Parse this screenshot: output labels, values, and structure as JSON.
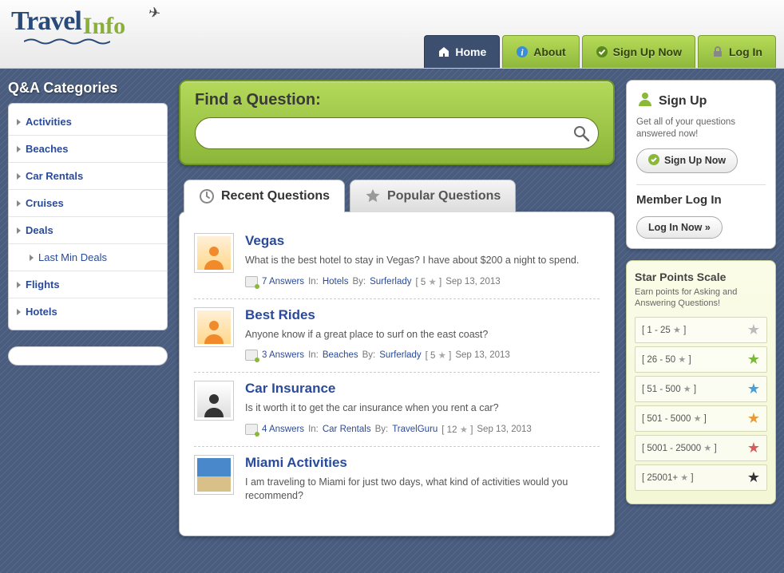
{
  "logo": {
    "word1": "Travel",
    "word2": "Info"
  },
  "nav": [
    {
      "label": "Home",
      "icon": "home",
      "active": true
    },
    {
      "label": "About",
      "icon": "info",
      "active": false
    },
    {
      "label": "Sign Up Now",
      "icon": "check",
      "active": false
    },
    {
      "label": "Log In",
      "icon": "lock",
      "active": false
    }
  ],
  "sidebar": {
    "title": "Q&A Categories",
    "items": [
      {
        "label": "Activities"
      },
      {
        "label": "Beaches"
      },
      {
        "label": "Car Rentals"
      },
      {
        "label": "Cruises"
      },
      {
        "label": "Deals"
      },
      {
        "label": "Last Min Deals",
        "sub": true
      },
      {
        "label": "Flights"
      },
      {
        "label": "Hotels"
      }
    ]
  },
  "search": {
    "title": "Find a Question:",
    "value": "",
    "placeholder": ""
  },
  "tabs": {
    "recent": "Recent Questions",
    "popular": "Popular Questions"
  },
  "questions": [
    {
      "title": "Vegas",
      "text": "What is the best hotel to stay in Vegas? I have about $200 a night to spend.",
      "answers": "7 Answers",
      "category": "Hotels",
      "author": "Surferlady",
      "stars": "5",
      "date": "Sep 13, 2013",
      "avatar": "orange"
    },
    {
      "title": "Best Rides",
      "text": "Anyone know if a great place to surf on the east coast?",
      "answers": "3 Answers",
      "category": "Beaches",
      "author": "Surferlady",
      "stars": "5",
      "date": "Sep 13, 2013",
      "avatar": "orange"
    },
    {
      "title": "Car Insurance",
      "text": "Is it worth it to get the car insurance when you rent a car?",
      "answers": "4 Answers",
      "category": "Car Rentals",
      "author": "TravelGuru",
      "stars": "12",
      "date": "Sep 13, 2013",
      "avatar": "gray"
    },
    {
      "title": "Miami Activities",
      "text": "I am traveling to Miami for just two days, what kind of activities would you recommend?",
      "answers": "",
      "category": "",
      "author": "",
      "stars": "",
      "date": "",
      "avatar": "photo"
    }
  ],
  "signup": {
    "title": "Sign Up",
    "sub": "Get all of your questions answered now!",
    "button": "Sign Up Now"
  },
  "login": {
    "title": "Member Log In",
    "button": "Log In Now »"
  },
  "scale": {
    "title": "Star Points Scale",
    "sub": "Earn points for Asking and Answering Questions!",
    "rows": [
      {
        "range": "1 - 25",
        "starColor": "gray"
      },
      {
        "range": "26 - 50",
        "starColor": "green"
      },
      {
        "range": "51 - 500",
        "starColor": "blue"
      },
      {
        "range": "501 - 5000",
        "starColor": "orange"
      },
      {
        "range": "5001 - 25000",
        "starColor": "red"
      },
      {
        "range": "25001+",
        "starColor": "black"
      }
    ]
  },
  "meta_labels": {
    "in": "In:",
    "by": "By:"
  }
}
